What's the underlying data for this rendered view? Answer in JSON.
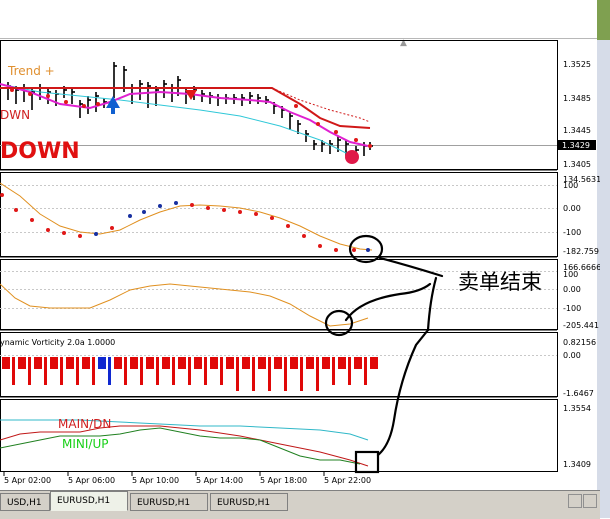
{
  "colors": {
    "candle": "#000000",
    "trend_line": "#d01818",
    "ma_magenta": "#e020d0",
    "ma_cyan": "#30c8d8",
    "dots_red": "#e01818",
    "dots_blue": "#1830a0",
    "orange": "#e09020",
    "hist_red": "#e00808",
    "hist_blue": "#1028d0",
    "main_dn": "#c01818",
    "mini_up": "#208020",
    "cyan_line": "#30b8c8",
    "current_price_bg": "#000000"
  },
  "main_chart": {
    "trend_label": "Trend",
    "trend_label_plus": "+",
    "down_small": "DWN",
    "down_big": "DOWN",
    "price_axis": [
      "1.3525",
      "1.3485",
      "1.3445",
      "1.3405"
    ],
    "current_price": "1.3429"
  },
  "panel1": {
    "axis": [
      "134.5631",
      "100",
      "0.00",
      "-100",
      "-182.759"
    ]
  },
  "panel2": {
    "axis": [
      "166.6666",
      "100",
      "0.00",
      "-100",
      "-205.441"
    ]
  },
  "panel3": {
    "title": "ynamic Vorticity 2.0a 1.0000",
    "axis": [
      "0.82156",
      "0.00",
      "-1.6467"
    ],
    "bar_colors": [
      "red",
      "red",
      "red",
      "red",
      "red",
      "red",
      "red",
      "red",
      "red",
      "red",
      "red",
      "red",
      "blue",
      "blue",
      "red",
      "red",
      "red",
      "red",
      "red",
      "red",
      "red",
      "red",
      "red",
      "red",
      "red",
      "red",
      "red",
      "red",
      "red",
      "red",
      "red",
      "red",
      "red",
      "red",
      "red",
      "red",
      "red",
      "red",
      "red",
      "red",
      "red",
      "red",
      "red",
      "red",
      "red",
      "red",
      "red"
    ]
  },
  "panel4": {
    "label_main": "MAIN/DN",
    "label_mini": "MINI/UP",
    "axis": [
      "1.3554",
      "1.3409"
    ]
  },
  "time_axis": [
    "5 Apr 02:00",
    "5 Apr 06:00",
    "5 Apr 10:00",
    "5 Apr 14:00",
    "5 Apr 18:00",
    "5 Apr 22:00"
  ],
  "annotation": "卖单结束",
  "tabs": [
    {
      "label": "USD,H1",
      "active": false
    },
    {
      "label": "EURUSD,H1",
      "active": true
    },
    {
      "label": "EURUSD,H1",
      "active": false
    },
    {
      "label": "EURUSD,H1",
      "active": false
    }
  ]
}
